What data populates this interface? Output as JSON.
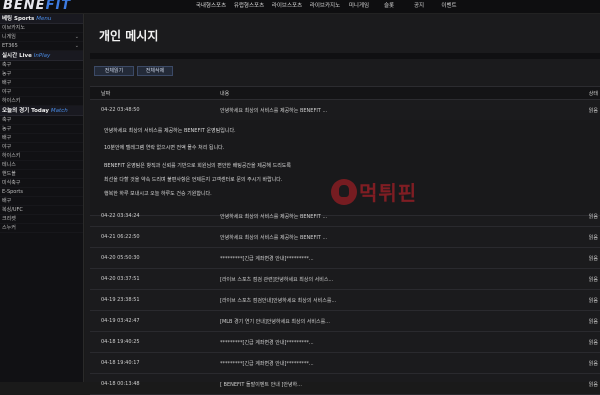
{
  "brand": {
    "logo_main": "BENE",
    "logo_accent": "FIT"
  },
  "nav": [
    "국내형스포츠",
    "유럽형스포츠",
    "라이브스포츠",
    "라이브카지노",
    "미니게임",
    "슬롯",
    "공지",
    "이벤트"
  ],
  "sidebar": {
    "head1": {
      "ko": "베팅 Sports",
      "en": "Menu"
    },
    "menu_items": [
      {
        "label": "이브카지노",
        "chevron": ""
      },
      {
        "label": "니게임",
        "chevron": "⌄"
      },
      {
        "label": "ET365",
        "chevron": "⌄"
      }
    ],
    "head2": {
      "ko": "실시간 Live",
      "en": "InPlay"
    },
    "live_items": [
      "축구",
      "농구",
      "배구",
      "야구",
      "하이스키"
    ],
    "head3": {
      "ko": "오늘의 경기 Today",
      "en": "Match"
    },
    "today_items": [
      "축구",
      "농구",
      "배구",
      "야구",
      "하이스키",
      "테니스",
      "핸드볼",
      "미식축구",
      "E-Sports",
      "배구",
      "복싱/UFC",
      "크리켓",
      "스누커"
    ]
  },
  "page": {
    "title": "개인 메시지"
  },
  "buttons": {
    "read_all": "전체읽기",
    "delete_all": "전체삭제"
  },
  "table": {
    "headers": {
      "date": "날짜",
      "content": "내용",
      "status": "상태"
    },
    "first_row": {
      "date": "04-22 03:48:50",
      "title": "안녕하세요 최상의 서비스를 제공하는 BENEFIT ...",
      "status": "읽음"
    },
    "expanded_lines": [
      "안녕하세요 최상의 서비스를 제공하는 BENEFIT 운영팀입니다.",
      "10분안에 텔레그램 연락 없으시면 전액 몰수 처리 됩니다.",
      "BENEFIT 운영팀은 항직과 신뢰를 기반으로 회원님의 편안한 배팅공간을 제공해 드리도록",
      "최선을 다할 것을 약속 드리며 불편사항은 언제든지 고객센터로 문의 주시기 바랍니다.",
      "행복한 하루 보내시고 오늘 하루도 건승 기원합니다."
    ],
    "rows": [
      {
        "date": "04-22 03:34:24",
        "title": "안녕하세요 최상의 서비스를 제공하는 BENEFIT ...",
        "status": "읽음"
      },
      {
        "date": "04-21 06:22:50",
        "title": "안녕하세요 최상의 서비스를 제공하는 BENEFIT ...",
        "status": "읽음"
      },
      {
        "date": "04-20 05:50:30",
        "title": "*********[긴급 계좌변경 안내]*********...",
        "status": "읽음"
      },
      {
        "date": "04-20 03:37:51",
        "title": "[라이브 스포츠 점검 관련]안녕하세요 최상의 서비스...",
        "status": "읽음"
      },
      {
        "date": "04-19 23:38:51",
        "title": "[라이브 스포츠 점검안내]안녕하세요 최상의 서비스를...",
        "status": "읽음"
      },
      {
        "date": "04-19 03:42:47",
        "title": "[MLB 경기 연기 안내]안녕하세요 최상의 서비스를...",
        "status": "읽음"
      },
      {
        "date": "04-18 19:40:25",
        "title": "*********[긴급 계좌변경 안내]*********...",
        "status": "읽음"
      },
      {
        "date": "04-18 19:40:17",
        "title": "*********[긴급 계좌변경 안내]*********...",
        "status": "읽음"
      },
      {
        "date": "04-18 00:13:48",
        "title": "[ BENEFIT 돌발이벤트 안내 ]안녕하...",
        "status": "읽음"
      }
    ]
  },
  "watermark": {
    "text": "먹튀핀"
  }
}
